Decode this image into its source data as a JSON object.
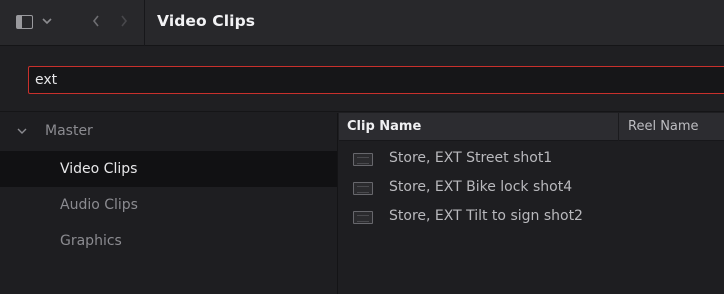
{
  "header": {
    "title": "Video Clips",
    "icons": {
      "panel_toggle": "sidebar-panel-icon",
      "dropdown": "chevron-down-icon",
      "back": "chevron-left-icon",
      "forward": "chevron-right-icon"
    }
  },
  "search": {
    "value": "ext",
    "border_color": "#c8302c"
  },
  "bins": {
    "root": {
      "label": "Master",
      "expanded": true
    },
    "items": [
      {
        "label": "Video Clips",
        "selected": true
      },
      {
        "label": "Audio Clips",
        "selected": false
      },
      {
        "label": "Graphics",
        "selected": false
      }
    ]
  },
  "clip_table": {
    "columns": [
      "Clip Name",
      "Reel Name"
    ],
    "rows": [
      {
        "clip_name": "Store, EXT Street shot1",
        "icon": "video-clip-icon"
      },
      {
        "clip_name": "Store, EXT Bike lock shot4",
        "icon": "video-clip-icon"
      },
      {
        "clip_name": "Store, EXT Tilt to sign shot2",
        "icon": "video-clip-icon"
      }
    ]
  },
  "colors": {
    "background": "#1e1e21",
    "selected_row": "#111113",
    "search_focus": "#c8302c"
  }
}
